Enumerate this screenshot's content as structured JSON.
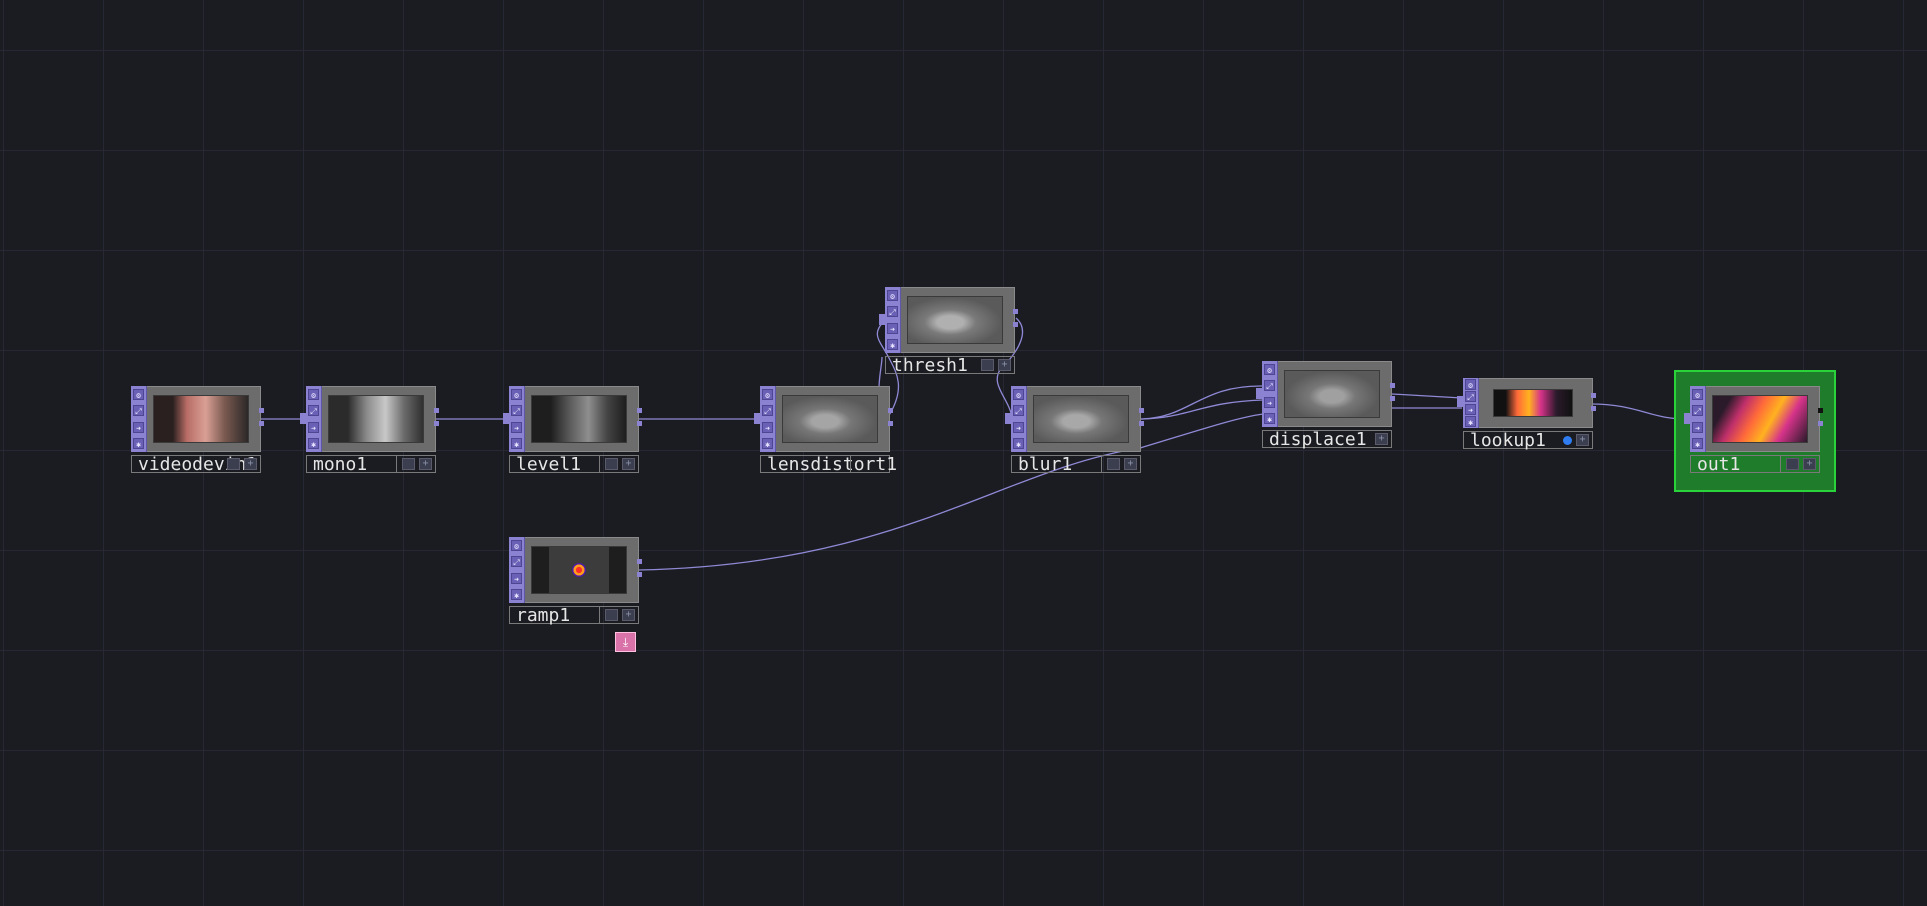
{
  "canvas": {
    "background": "#1b1c21",
    "wire_color": "#8f89d6",
    "accent_selected": "#2ad33a"
  },
  "nodes": [
    {
      "id": "videodevin1",
      "name": "videodevin1",
      "thumbnail": "color-hand"
    },
    {
      "id": "mono1",
      "name": "mono1",
      "thumbnail": "grey-hand"
    },
    {
      "id": "level1",
      "name": "level1",
      "thumbnail": "dark-hand"
    },
    {
      "id": "lensdistort1",
      "name": "lensdistort1",
      "thumbnail": "grey-blur"
    },
    {
      "id": "thresh1",
      "name": "thresh1",
      "thumbnail": "grey-blur"
    },
    {
      "id": "blur1",
      "name": "blur1",
      "thumbnail": "grey-blur"
    },
    {
      "id": "displace1",
      "name": "displace1",
      "thumbnail": "grey-blur"
    },
    {
      "id": "lookup1",
      "name": "lookup1",
      "thumbnail": "fire-hand"
    },
    {
      "id": "out1",
      "name": "out1",
      "thumbnail": "fire-hand",
      "selected": true
    },
    {
      "id": "ramp1",
      "name": "ramp1",
      "thumbnail": "radial-ramp"
    }
  ],
  "icons": {
    "flags": [
      "gear-icon",
      "bypass-icon",
      "display-icon",
      "lock-icon"
    ],
    "pin": "pin-icon"
  },
  "glyphs": {
    "flag1": "⚙",
    "flag2": "⤢",
    "flag3": "➜",
    "flag4": "✱",
    "plus": "+",
    "pin": "⤓"
  }
}
